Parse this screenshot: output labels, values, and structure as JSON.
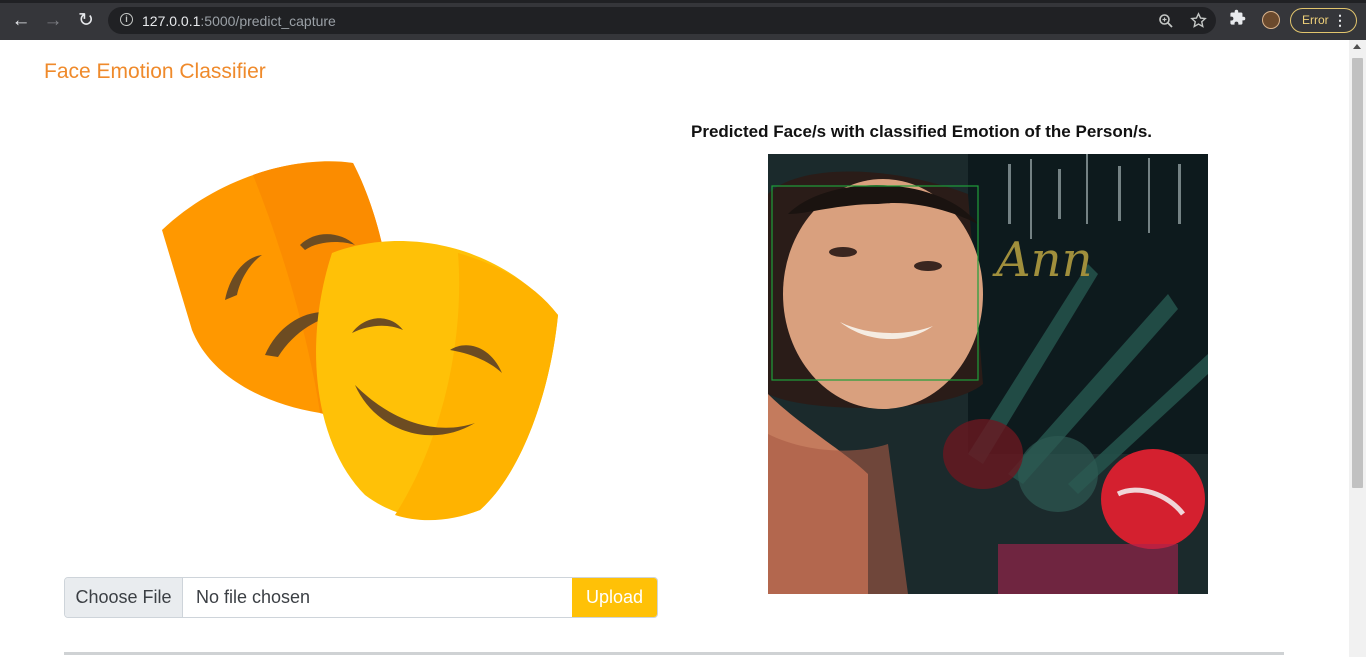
{
  "browser": {
    "url_host": "127.0.0.1",
    "url_path": ":5000/predict_capture",
    "error_label": "Error"
  },
  "page": {
    "brand": "Face Emotion Classifier",
    "result_heading": "Predicted Face/s with classified Emotion of the Person/s.",
    "choose_file_label": "Choose File",
    "file_status": "No file chosen",
    "upload_label": "Upload",
    "photo_overlay_text": "Ann"
  },
  "colors": {
    "brand": "#ef8a2b",
    "upload_button": "#ffc107",
    "detection_box": "#1f9e3a"
  },
  "icons": [
    "back-icon",
    "forward-icon",
    "reload-icon",
    "info-icon",
    "zoom-icon",
    "star-icon",
    "extensions-icon",
    "avatar",
    "menu-dots-icon",
    "theater-masks-icon"
  ]
}
